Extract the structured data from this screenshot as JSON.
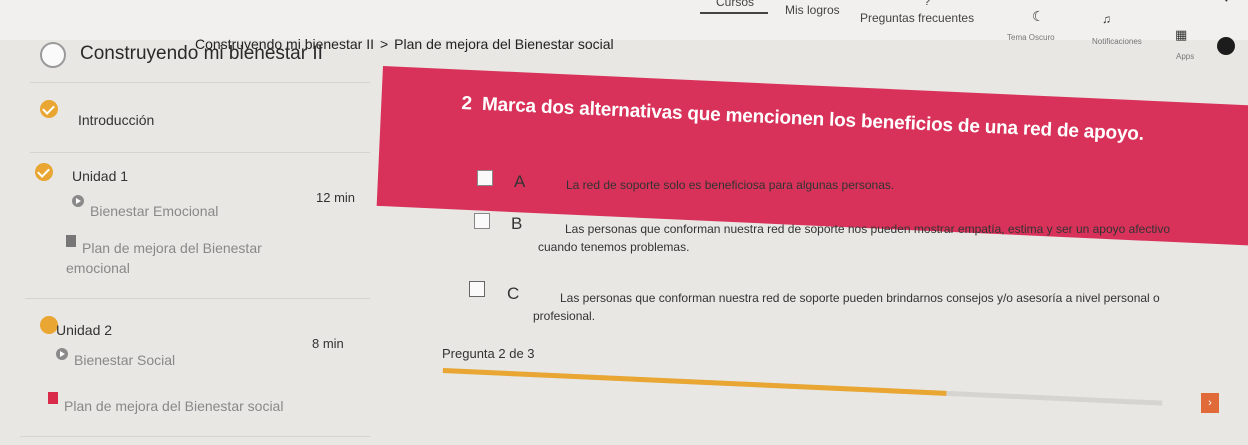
{
  "nav": {
    "courses": "Cursos",
    "achievements": "Mis logros",
    "faq": "Preguntas frecuentes",
    "dark_theme": "Tema Oscuro",
    "notifications": "Notificaciones",
    "apps": "Apps",
    "help_badge": "?"
  },
  "breadcrumb": {
    "course": "Construyendo mi bienestar II",
    "separator": ">",
    "current": "Plan de mejora del Bienestar social"
  },
  "sidebar": {
    "course_title": "Construyendo mi bienestar II",
    "intro": "Introducción",
    "unit1": {
      "label": "Unidad 1",
      "time": "12 min",
      "lesson": "Bienestar Emocional",
      "plan_line1": "Plan de mejora del Bienestar",
      "plan_line2": "emocional"
    },
    "unit2": {
      "label": "Unidad 2",
      "time": "8 min",
      "lesson": "Bienestar Social",
      "plan": "Plan de mejora del Bienestar social"
    }
  },
  "question": {
    "number": "2",
    "text": "Marca dos alternativas que mencionen los beneficios de una red de apoyo.",
    "options": [
      {
        "letter": "A",
        "line1": "La red de soporte solo es beneficiosa para algunas personas.",
        "line2": ""
      },
      {
        "letter": "B",
        "line1": "Las personas que conforman nuestra red de soporte nos pueden mostrar empatía, estima y ser un apoyo afectivo",
        "line2": "cuando tenemos problemas."
      },
      {
        "letter": "C",
        "line1": "Las personas que conforman nuestra red de soporte pueden brindarnos consejos y/o asesoría a nivel personal o",
        "line2": "profesional."
      }
    ],
    "counter": "Pregunta 2 de 3",
    "progress": 0.7,
    "next_symbol": "›"
  },
  "colors": {
    "accent": "#d9325a",
    "progress": "#e9a632",
    "next": "#e06a38"
  }
}
